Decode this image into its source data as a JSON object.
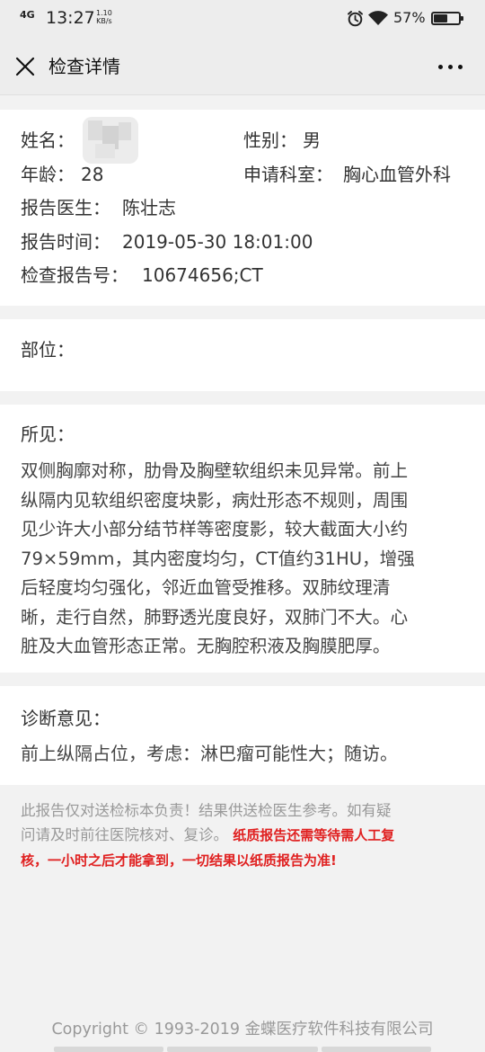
{
  "status_bar": {
    "network": "4G",
    "time": "13:27",
    "speed_value": "1.10",
    "speed_unit": "KB/s",
    "battery_percent": "57%",
    "battery_level": 0.57
  },
  "nav": {
    "title": "检查详情"
  },
  "patient": {
    "name_label": "姓名：",
    "gender_label": "性别：",
    "gender_value": "男",
    "age_label": "年龄：",
    "age_value": "28",
    "department_label": "申请科室：",
    "department_value": "胸心血管外科",
    "doctor_label": "报告医生：",
    "doctor_value": "陈壮志",
    "report_time_label": "报告时间：",
    "report_time_value": "2019-05-30 18:01:00",
    "report_no_label": "检查报告号：",
    "report_no_value": "10674656;CT"
  },
  "position": {
    "label": "部位："
  },
  "findings": {
    "label": "所见：",
    "lines": [
      "双侧胸廓对称，肋骨及胸壁软组织未见异常。前上",
      "纵隔内见软组织密度块影，病灶形态不规则，周围",
      "见少许大小部分结节样等密度影，较大截面大小约",
      "79×59mm，其内密度均匀，CT值约31HU，增强",
      "后轻度均匀强化，邻近血管受推移。双肺纹理清",
      "晰，走行自然，肺野透光度良好，双肺门不大。心",
      "脏及大血管形态正常。无胸腔积液及胸膜肥厚。"
    ]
  },
  "diagnosis": {
    "label": "诊断意见：",
    "text": "前上纵隔占位，考虑：淋巴瘤可能性大；随访。"
  },
  "notice": {
    "line1": "此报告仅对送检标本负责！结果供送检医生参考。如有疑",
    "line2_gray": "问请及时前往医院核对、复诊。",
    "line2_red": "纸质报告还需等待需人工复",
    "line3_red": "核，一小时之后才能拿到，一切结果以纸质报告为准!"
  },
  "footer": {
    "copyright": "Copyright © 1993-2019 金蝶医疗软件科技有限公司"
  }
}
